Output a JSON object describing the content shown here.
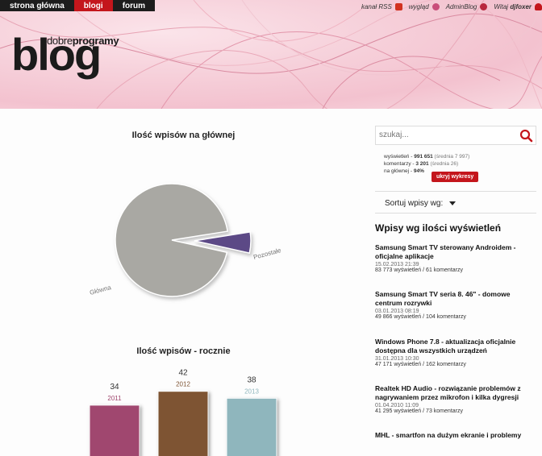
{
  "nav": {
    "tabs": [
      "strona główna",
      "blogi",
      "forum"
    ],
    "active": 1
  },
  "toplinks": {
    "rss": "kanał RSS",
    "look": "wygląd",
    "admin": "AdminBlog",
    "welcome": "Witaj",
    "user": "djfoxer"
  },
  "brand": {
    "small_a": "dobre",
    "small_b": "programy",
    "big": "blog"
  },
  "pie": {
    "title": "Ilość wpisów na głównej",
    "chart_data": {
      "type": "pie",
      "labels": [
        "Główna",
        "Pozostałe"
      ],
      "values": [
        94,
        6
      ],
      "colors": [
        "#a9a8a3",
        "#5b4a86"
      ]
    }
  },
  "bars": {
    "title": "Ilość wpisów - rocznie",
    "chart_data": {
      "type": "bar",
      "categories": [
        "2011",
        "2012",
        "2013"
      ],
      "values": [
        34,
        42,
        38
      ],
      "colors": [
        "#a0476f",
        "#7e5433",
        "#8fb6bd"
      ]
    }
  },
  "search": {
    "placeholder": "szukaj..."
  },
  "stats": {
    "views_label": "wyświetleń",
    "views": "991 651",
    "views_avg": "(średnia 7 997)",
    "comments_label": "komentarzy",
    "comments": "3 201",
    "comments_avg": "(średnia 26)",
    "main_label": "na głównej",
    "main_pct": "94%",
    "hide_button": "ukryj wykresy"
  },
  "sort": {
    "label": "Sortuj wpisy wg:"
  },
  "list": {
    "title": "Wpisy wg ilości wyświetleń",
    "posts": [
      {
        "title": "Samsung Smart TV sterowany Androidem - oficjalne aplikacje",
        "date": "15.02.2013 21:39",
        "views": "83 773 wyświetleń",
        "comments": "61 komentarzy"
      },
      {
        "title": "Samsung Smart TV seria 8. 46\" - domowe centrum rozrywki",
        "date": "03.01.2013 08:19",
        "views": "49 866 wyświetleń",
        "comments": "104 komentarzy"
      },
      {
        "title": "Windows Phone 7.8 - aktualizacja oficjalnie dostępna dla wszystkich urządzeń",
        "date": "31.01.2013 10:30",
        "views": "47 171 wyświetleń",
        "comments": "162 komentarzy"
      },
      {
        "title": "Realtek HD Audio - rozwiązanie problemów z nagrywaniem przez mikrofon i kilka dygresji",
        "date": "01.04.2010 11:09",
        "views": "41 295 wyświetleń",
        "comments": "73 komentarzy"
      },
      {
        "title": "MHL - smartfon na dużym ekranie i problemy",
        "date": "",
        "views": "",
        "comments": ""
      }
    ]
  },
  "colors": {
    "accent": "#c4161c",
    "dark": "#1d1d1d"
  }
}
